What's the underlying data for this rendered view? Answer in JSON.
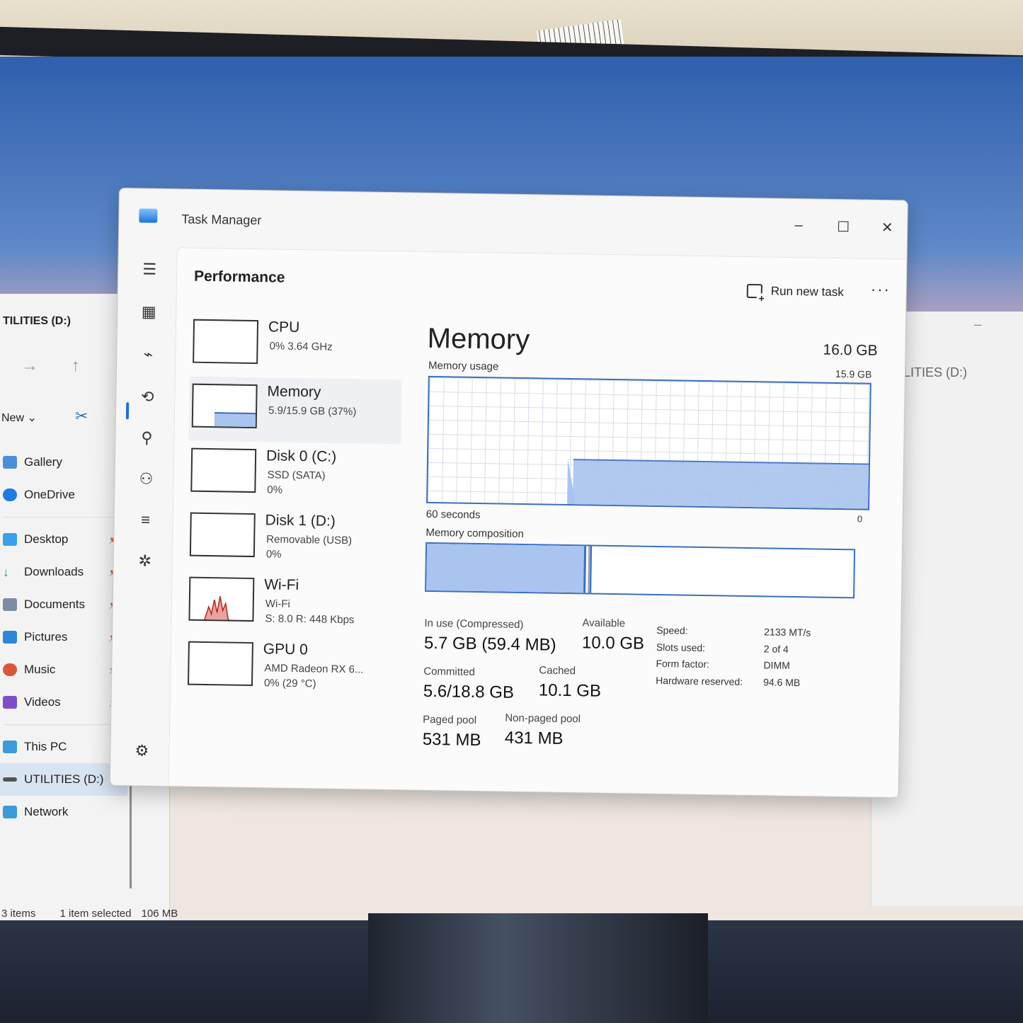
{
  "task_manager": {
    "title": "Task Manager",
    "window_controls": {
      "minimize": "–",
      "maximize": "☐",
      "close": "✕"
    },
    "page_title": "Performance",
    "run_new_task": "Run new task",
    "more": "···",
    "devices": [
      {
        "name": "CPU",
        "line1": "0% 3.64 GHz",
        "line2": "",
        "line3": ""
      },
      {
        "name": "Memory",
        "line1": "5.9/15.9 GB (37%)",
        "line2": "",
        "line3": "",
        "selected": true
      },
      {
        "name": "Disk 0 (C:)",
        "line1": "SSD (SATA)",
        "line2": "0%",
        "line3": ""
      },
      {
        "name": "Disk 1 (D:)",
        "line1": "Removable (USB)",
        "line2": "0%",
        "line3": ""
      },
      {
        "name": "Wi-Fi",
        "line1": "Wi-Fi",
        "line2": "S: 8.0 R: 448 Kbps",
        "line3": ""
      },
      {
        "name": "GPU 0",
        "line1": "AMD Radeon RX 6...",
        "line2": "0% (29 °C)",
        "line3": ""
      }
    ],
    "memory": {
      "title": "Memory",
      "total": "16.0 GB",
      "usage_label": "Memory usage",
      "usage_max": "15.9 GB",
      "time_label": "60 seconds",
      "time_zero": "0",
      "composition_label": "Memory composition",
      "in_use_label": "In use (Compressed)",
      "in_use_value": "5.7 GB (59.4 MB)",
      "available_label": "Available",
      "available_value": "10.0 GB",
      "committed_label": "Committed",
      "committed_value": "5.6/18.8 GB",
      "cached_label": "Cached",
      "cached_value": "10.1 GB",
      "paged_label": "Paged pool",
      "paged_value": "531 MB",
      "nonpaged_label": "Non-paged pool",
      "nonpaged_value": "431 MB",
      "specs": [
        {
          "k": "Speed:",
          "v": "2133 MT/s"
        },
        {
          "k": "Slots used:",
          "v": "2 of 4"
        },
        {
          "k": "Form factor:",
          "v": "DIMM"
        },
        {
          "k": "Hardware reserved:",
          "v": "94.6 MB"
        }
      ]
    }
  },
  "explorer": {
    "title": "TILITIES (D:)",
    "new_label": "New",
    "nav": [
      {
        "label": "Gallery",
        "pinned": false
      },
      {
        "label": "OneDrive",
        "pinned": false
      },
      {
        "label": "Desktop",
        "pinned": true
      },
      {
        "label": "Downloads",
        "pinned": true
      },
      {
        "label": "Documents",
        "pinned": true
      },
      {
        "label": "Pictures",
        "pinned": true
      },
      {
        "label": "Music",
        "pinned": true
      },
      {
        "label": "Videos",
        "pinned": true
      },
      {
        "label": "This PC",
        "pinned": false
      },
      {
        "label": "UTILITIES (D:)",
        "pinned": false
      },
      {
        "label": "Network",
        "pinned": false
      }
    ],
    "status_items": "3 items",
    "status_selected": "1 item selected",
    "status_size": "106 MB"
  },
  "explorer2": {
    "title": "ILITIES (D:)"
  },
  "colors": {
    "accent": "#3a6fc4",
    "fill": "#a9c4ee"
  }
}
